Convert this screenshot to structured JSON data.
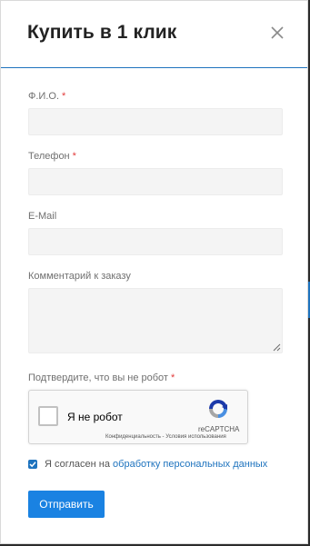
{
  "modal": {
    "title": "Купить в 1 клик"
  },
  "form": {
    "required_mark": "*",
    "fio_label": "Ф.И.О.",
    "fio_value": "",
    "phone_label": "Телефон",
    "phone_value": "",
    "email_label": "E-Mail",
    "email_value": "",
    "comment_label": "Комментарий к заказу",
    "comment_value": "",
    "captcha_prompt": "Подтвердите, что вы не робот"
  },
  "captcha": {
    "checkbox_label": "Я не робот",
    "brand": "reCAPTCHA",
    "links": "Конфиденциальность - Условия использования"
  },
  "consent": {
    "checked": true,
    "text_prefix": "Я согласен на ",
    "link_text": "обработку персональных данных"
  },
  "actions": {
    "submit_label": "Отправить"
  },
  "colors": {
    "accent": "#1a82e2",
    "required": "#e23b3b",
    "link": "#1e73be"
  }
}
